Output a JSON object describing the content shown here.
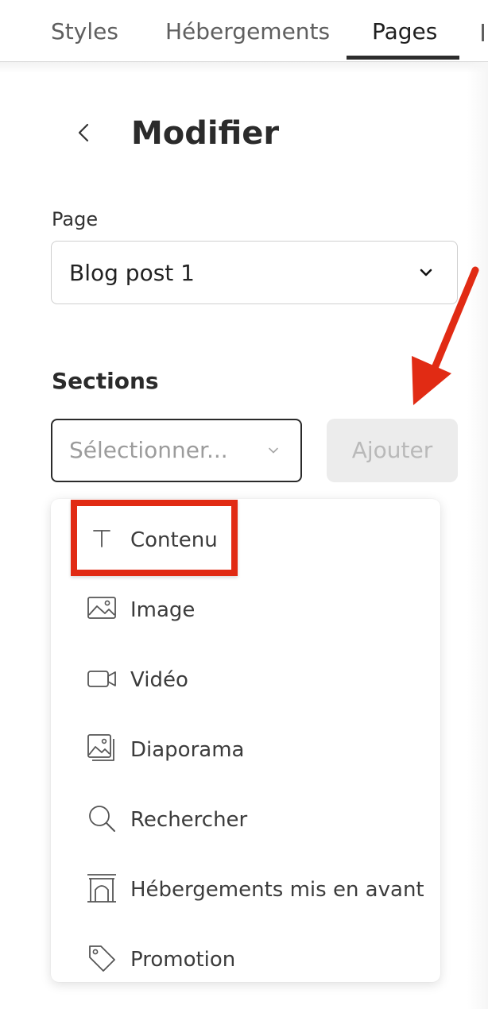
{
  "tabs": [
    {
      "label": "Styles",
      "active": false
    },
    {
      "label": "Hébergements",
      "active": false
    },
    {
      "label": "Pages",
      "active": true
    }
  ],
  "header": {
    "title": "Modifier",
    "back_icon": "chevron-left-icon"
  },
  "page_field": {
    "label": "Page",
    "value": "Blog post 1",
    "icon": "chevron-down-icon"
  },
  "sections": {
    "label": "Sections",
    "select_placeholder": "Sélectionner...",
    "add_label": "Ajouter",
    "add_disabled": true
  },
  "menu": {
    "items": [
      {
        "label": "Contenu",
        "icon": "text-icon"
      },
      {
        "label": "Image",
        "icon": "image-icon"
      },
      {
        "label": "Vidéo",
        "icon": "video-icon"
      },
      {
        "label": "Diaporama",
        "icon": "slideshow-icon"
      },
      {
        "label": "Rechercher",
        "icon": "search-icon"
      },
      {
        "label": "Hébergements mis en avant",
        "icon": "featured-lodging-icon"
      },
      {
        "label": "Promotion",
        "icon": "tag-icon"
      }
    ]
  },
  "annotation": {
    "color": "#e12b14",
    "highlighted_item": "Contenu"
  }
}
